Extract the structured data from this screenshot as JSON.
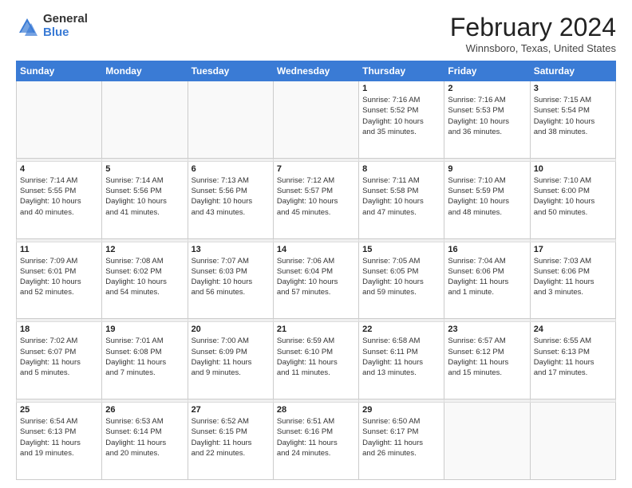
{
  "header": {
    "logo_general": "General",
    "logo_blue": "Blue",
    "month_title": "February 2024",
    "location": "Winnsboro, Texas, United States"
  },
  "days_of_week": [
    "Sunday",
    "Monday",
    "Tuesday",
    "Wednesday",
    "Thursday",
    "Friday",
    "Saturday"
  ],
  "weeks": [
    [
      {
        "num": "",
        "info": ""
      },
      {
        "num": "",
        "info": ""
      },
      {
        "num": "",
        "info": ""
      },
      {
        "num": "",
        "info": ""
      },
      {
        "num": "1",
        "info": "Sunrise: 7:16 AM\nSunset: 5:52 PM\nDaylight: 10 hours\nand 35 minutes."
      },
      {
        "num": "2",
        "info": "Sunrise: 7:16 AM\nSunset: 5:53 PM\nDaylight: 10 hours\nand 36 minutes."
      },
      {
        "num": "3",
        "info": "Sunrise: 7:15 AM\nSunset: 5:54 PM\nDaylight: 10 hours\nand 38 minutes."
      }
    ],
    [
      {
        "num": "4",
        "info": "Sunrise: 7:14 AM\nSunset: 5:55 PM\nDaylight: 10 hours\nand 40 minutes."
      },
      {
        "num": "5",
        "info": "Sunrise: 7:14 AM\nSunset: 5:56 PM\nDaylight: 10 hours\nand 41 minutes."
      },
      {
        "num": "6",
        "info": "Sunrise: 7:13 AM\nSunset: 5:56 PM\nDaylight: 10 hours\nand 43 minutes."
      },
      {
        "num": "7",
        "info": "Sunrise: 7:12 AM\nSunset: 5:57 PM\nDaylight: 10 hours\nand 45 minutes."
      },
      {
        "num": "8",
        "info": "Sunrise: 7:11 AM\nSunset: 5:58 PM\nDaylight: 10 hours\nand 47 minutes."
      },
      {
        "num": "9",
        "info": "Sunrise: 7:10 AM\nSunset: 5:59 PM\nDaylight: 10 hours\nand 48 minutes."
      },
      {
        "num": "10",
        "info": "Sunrise: 7:10 AM\nSunset: 6:00 PM\nDaylight: 10 hours\nand 50 minutes."
      }
    ],
    [
      {
        "num": "11",
        "info": "Sunrise: 7:09 AM\nSunset: 6:01 PM\nDaylight: 10 hours\nand 52 minutes."
      },
      {
        "num": "12",
        "info": "Sunrise: 7:08 AM\nSunset: 6:02 PM\nDaylight: 10 hours\nand 54 minutes."
      },
      {
        "num": "13",
        "info": "Sunrise: 7:07 AM\nSunset: 6:03 PM\nDaylight: 10 hours\nand 56 minutes."
      },
      {
        "num": "14",
        "info": "Sunrise: 7:06 AM\nSunset: 6:04 PM\nDaylight: 10 hours\nand 57 minutes."
      },
      {
        "num": "15",
        "info": "Sunrise: 7:05 AM\nSunset: 6:05 PM\nDaylight: 10 hours\nand 59 minutes."
      },
      {
        "num": "16",
        "info": "Sunrise: 7:04 AM\nSunset: 6:06 PM\nDaylight: 11 hours\nand 1 minute."
      },
      {
        "num": "17",
        "info": "Sunrise: 7:03 AM\nSunset: 6:06 PM\nDaylight: 11 hours\nand 3 minutes."
      }
    ],
    [
      {
        "num": "18",
        "info": "Sunrise: 7:02 AM\nSunset: 6:07 PM\nDaylight: 11 hours\nand 5 minutes."
      },
      {
        "num": "19",
        "info": "Sunrise: 7:01 AM\nSunset: 6:08 PM\nDaylight: 11 hours\nand 7 minutes."
      },
      {
        "num": "20",
        "info": "Sunrise: 7:00 AM\nSunset: 6:09 PM\nDaylight: 11 hours\nand 9 minutes."
      },
      {
        "num": "21",
        "info": "Sunrise: 6:59 AM\nSunset: 6:10 PM\nDaylight: 11 hours\nand 11 minutes."
      },
      {
        "num": "22",
        "info": "Sunrise: 6:58 AM\nSunset: 6:11 PM\nDaylight: 11 hours\nand 13 minutes."
      },
      {
        "num": "23",
        "info": "Sunrise: 6:57 AM\nSunset: 6:12 PM\nDaylight: 11 hours\nand 15 minutes."
      },
      {
        "num": "24",
        "info": "Sunrise: 6:55 AM\nSunset: 6:13 PM\nDaylight: 11 hours\nand 17 minutes."
      }
    ],
    [
      {
        "num": "25",
        "info": "Sunrise: 6:54 AM\nSunset: 6:13 PM\nDaylight: 11 hours\nand 19 minutes."
      },
      {
        "num": "26",
        "info": "Sunrise: 6:53 AM\nSunset: 6:14 PM\nDaylight: 11 hours\nand 20 minutes."
      },
      {
        "num": "27",
        "info": "Sunrise: 6:52 AM\nSunset: 6:15 PM\nDaylight: 11 hours\nand 22 minutes."
      },
      {
        "num": "28",
        "info": "Sunrise: 6:51 AM\nSunset: 6:16 PM\nDaylight: 11 hours\nand 24 minutes."
      },
      {
        "num": "29",
        "info": "Sunrise: 6:50 AM\nSunset: 6:17 PM\nDaylight: 11 hours\nand 26 minutes."
      },
      {
        "num": "",
        "info": ""
      },
      {
        "num": "",
        "info": ""
      }
    ]
  ]
}
